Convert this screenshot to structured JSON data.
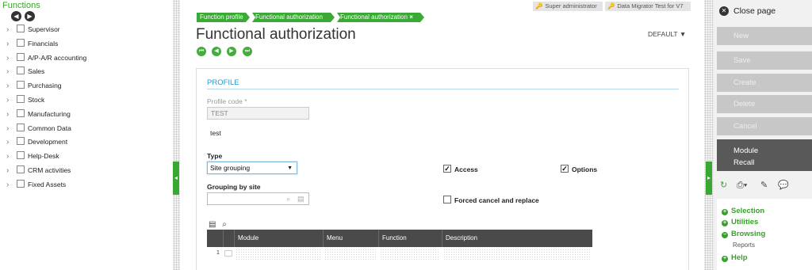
{
  "left_panel": {
    "title": "Functions",
    "prev_icon": "chevron-left-circle-icon",
    "next_icon": "chevron-right-circle-icon",
    "items": [
      {
        "label": "Supervisor"
      },
      {
        "label": "Financials"
      },
      {
        "label": "A/P-A/R accounting"
      },
      {
        "label": "Sales"
      },
      {
        "label": "Purchasing"
      },
      {
        "label": "Stock"
      },
      {
        "label": "Manufacturing"
      },
      {
        "label": "Common Data"
      },
      {
        "label": "Development"
      },
      {
        "label": "Help-Desk"
      },
      {
        "label": "CRM activities"
      },
      {
        "label": "Fixed Assets"
      }
    ]
  },
  "header": {
    "breadcrumbs": [
      "Function profile",
      "Functional authorization",
      "Functional authorization"
    ],
    "breadcrumb_close": "×",
    "user_role": "Super administrator",
    "endpoint": "Data Migrator Test for V7",
    "title": "Functional authorization",
    "view_selector": "DEFAULT",
    "record_nav_icons": [
      "first-record-icon",
      "previous-record-icon",
      "next-record-icon",
      "last-record-icon"
    ]
  },
  "form": {
    "section_title": "PROFILE",
    "profile_code_label": "Profile code",
    "profile_code_required_mark": "*",
    "profile_code_value": "TEST",
    "profile_description": "test",
    "type_label": "Type",
    "type_value": "Site grouping",
    "grouping_label": "Grouping by site",
    "grouping_value": "",
    "access_label": "Access",
    "access_checked": true,
    "options_label": "Options",
    "options_checked": true,
    "forced_cancel_label": "Forced cancel and replace",
    "forced_cancel_checked": false
  },
  "grid": {
    "columns": [
      "",
      "Module",
      "Menu",
      "Function",
      "Description"
    ],
    "rows": [
      {
        "num": "1",
        "module": "",
        "menu": "",
        "function": "",
        "description": ""
      }
    ]
  },
  "right_panel": {
    "close_label": "Close page",
    "actions": [
      "New",
      "Save",
      "Create",
      "Delete",
      "Cancel"
    ],
    "module_label": "Module",
    "recall_label": "Recall",
    "tool_icons": [
      "refresh-icon",
      "print-icon",
      "attachment-icon",
      "comment-icon"
    ],
    "links": {
      "selection": "Selection",
      "utilities": "Utilities",
      "browsing": "Browsing",
      "reports": "Reports",
      "help": "Help"
    }
  },
  "colors": {
    "accent_green": "#37a624",
    "section_blue": "#2c97c9",
    "grid_header": "#4a4a4a",
    "module_recall_bg": "#595959",
    "disabled_action_bg": "#c7c7c7"
  }
}
